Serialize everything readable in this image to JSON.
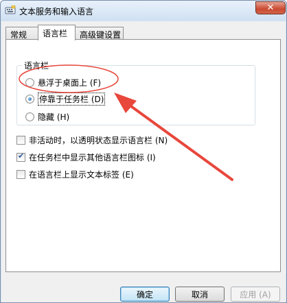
{
  "window": {
    "title": "文本服务和输入语言",
    "close_glyph": "✕"
  },
  "tabs": [
    {
      "label": "常规",
      "active": false
    },
    {
      "label": "语言栏",
      "active": true
    },
    {
      "label": "高级键设置",
      "active": false
    }
  ],
  "language_bar": {
    "group_title": "语言栏",
    "options": [
      {
        "label": "悬浮于桌面上 (F)",
        "checked": false
      },
      {
        "label": "停靠于任务栏 (D)",
        "checked": true
      },
      {
        "label": "隐藏 (H)",
        "checked": false
      }
    ]
  },
  "checkboxes": [
    {
      "label": "非活动时，以透明状态显示语言栏 (N)",
      "checked": false
    },
    {
      "label": "在任务栏中显示其他语言栏图标 (I)",
      "checked": true
    },
    {
      "label": "在语言栏上显示文本标签 (E)",
      "checked": false
    }
  ],
  "buttons": {
    "ok": "确定",
    "cancel": "取消",
    "apply": "应用 (A)"
  },
  "annotation_color": "#e8473c"
}
